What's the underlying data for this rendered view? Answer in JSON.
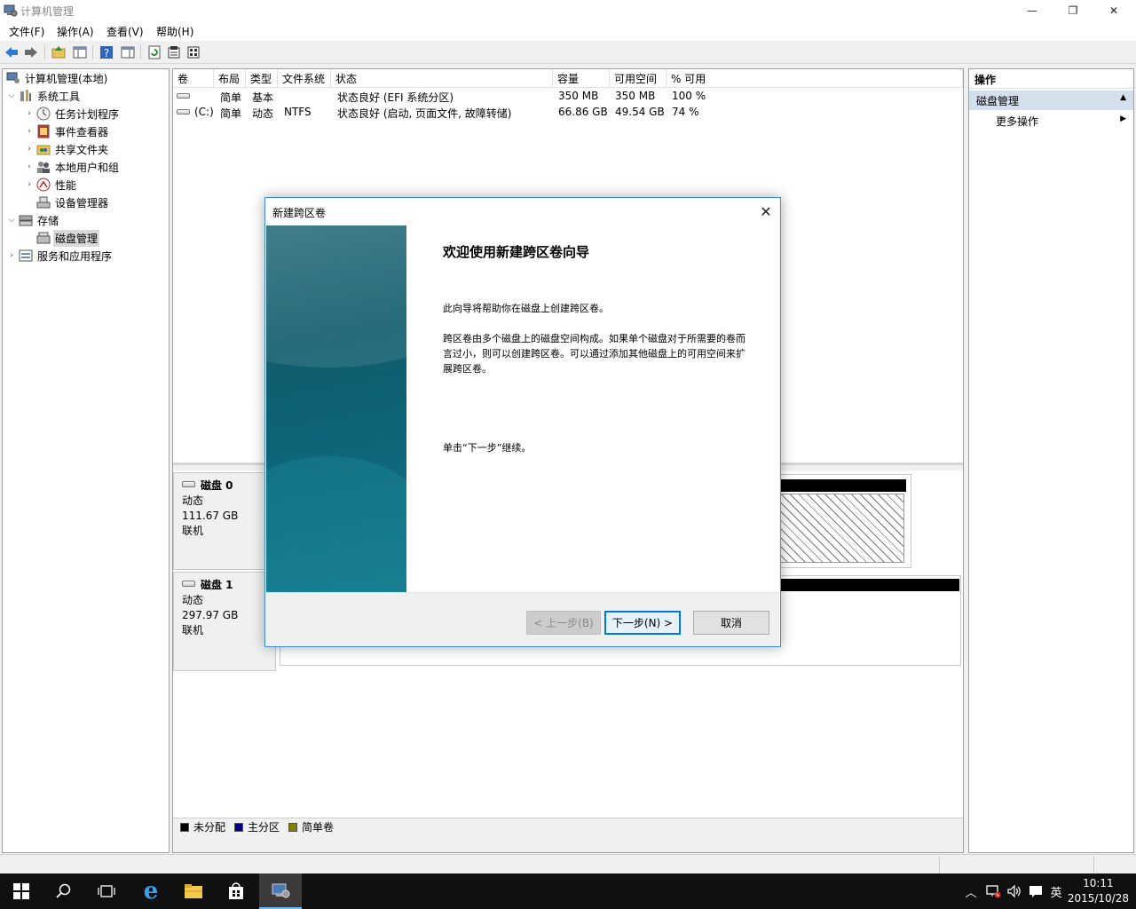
{
  "window": {
    "title": "计算机管理",
    "minimize": "—",
    "restore": "❐",
    "close": "✕"
  },
  "menu": {
    "items": [
      "文件(F)",
      "操作(A)",
      "查看(V)",
      "帮助(H)"
    ]
  },
  "toolbar": {
    "buttons": [
      "back-icon",
      "forward-icon",
      "up-folder-icon",
      "show-hide-tree-icon",
      "help-icon",
      "show-hide-action-icon",
      "refresh-icon",
      "properties-icon",
      "export-icon"
    ]
  },
  "tree": {
    "root": "计算机管理(本地)",
    "items": [
      {
        "label": "系统工具",
        "expanded": true
      },
      {
        "label": "任务计划程序"
      },
      {
        "label": "事件查看器"
      },
      {
        "label": "共享文件夹"
      },
      {
        "label": "本地用户和组"
      },
      {
        "label": "性能"
      },
      {
        "label": "设备管理器"
      },
      {
        "label": "存储",
        "expanded": true
      },
      {
        "label": "磁盘管理",
        "selected": true
      },
      {
        "label": "服务和应用程序"
      }
    ]
  },
  "volumes": {
    "columns": [
      "卷",
      "布局",
      "类型",
      "文件系统",
      "状态",
      "容量",
      "可用空间",
      "% 可用"
    ],
    "rows": [
      {
        "vol": "",
        "layout": "简单",
        "type": "基本",
        "fs": "",
        "status": "状态良好 (EFI 系统分区)",
        "capacity": "350 MB",
        "free": "350 MB",
        "pct": "100 %"
      },
      {
        "vol": "(C:)",
        "layout": "简单",
        "type": "动态",
        "fs": "NTFS",
        "status": "状态良好 (启动, 页面文件, 故障转储)",
        "capacity": "66.86 GB",
        "free": "49.54 GB",
        "pct": "74 %"
      }
    ]
  },
  "disks": [
    {
      "name": "磁盘 0",
      "kind": "动态",
      "size": "111.67 GB",
      "state": "联机"
    },
    {
      "name": "磁盘 1",
      "kind": "动态",
      "size": "297.97 GB",
      "state": "联机"
    }
  ],
  "legend": [
    {
      "label": "未分配",
      "color": "#000000"
    },
    {
      "label": "主分区",
      "color": "#000080"
    },
    {
      "label": "简单卷",
      "color": "#808000"
    }
  ],
  "actions": {
    "header": "操作",
    "section": "磁盘管理",
    "item": "更多操作"
  },
  "dialog": {
    "title": "新建跨区卷",
    "heading": "欢迎使用新建跨区卷向导",
    "p1": "此向导将帮助你在磁盘上创建跨区卷。",
    "p2": "跨区卷由多个磁盘上的磁盘空间构成。如果单个磁盘对于所需要的卷而言过小，则可以创建跨区卷。可以通过添加其他磁盘上的可用空间来扩展跨区卷。",
    "p3": "单击“下一步”继续。",
    "back": "< 上一步(B)",
    "next": "下一步(N) >",
    "cancel": "取消"
  },
  "taskbar": {
    "time": "10:11",
    "date": "2015/10/28",
    "ime": "英"
  }
}
